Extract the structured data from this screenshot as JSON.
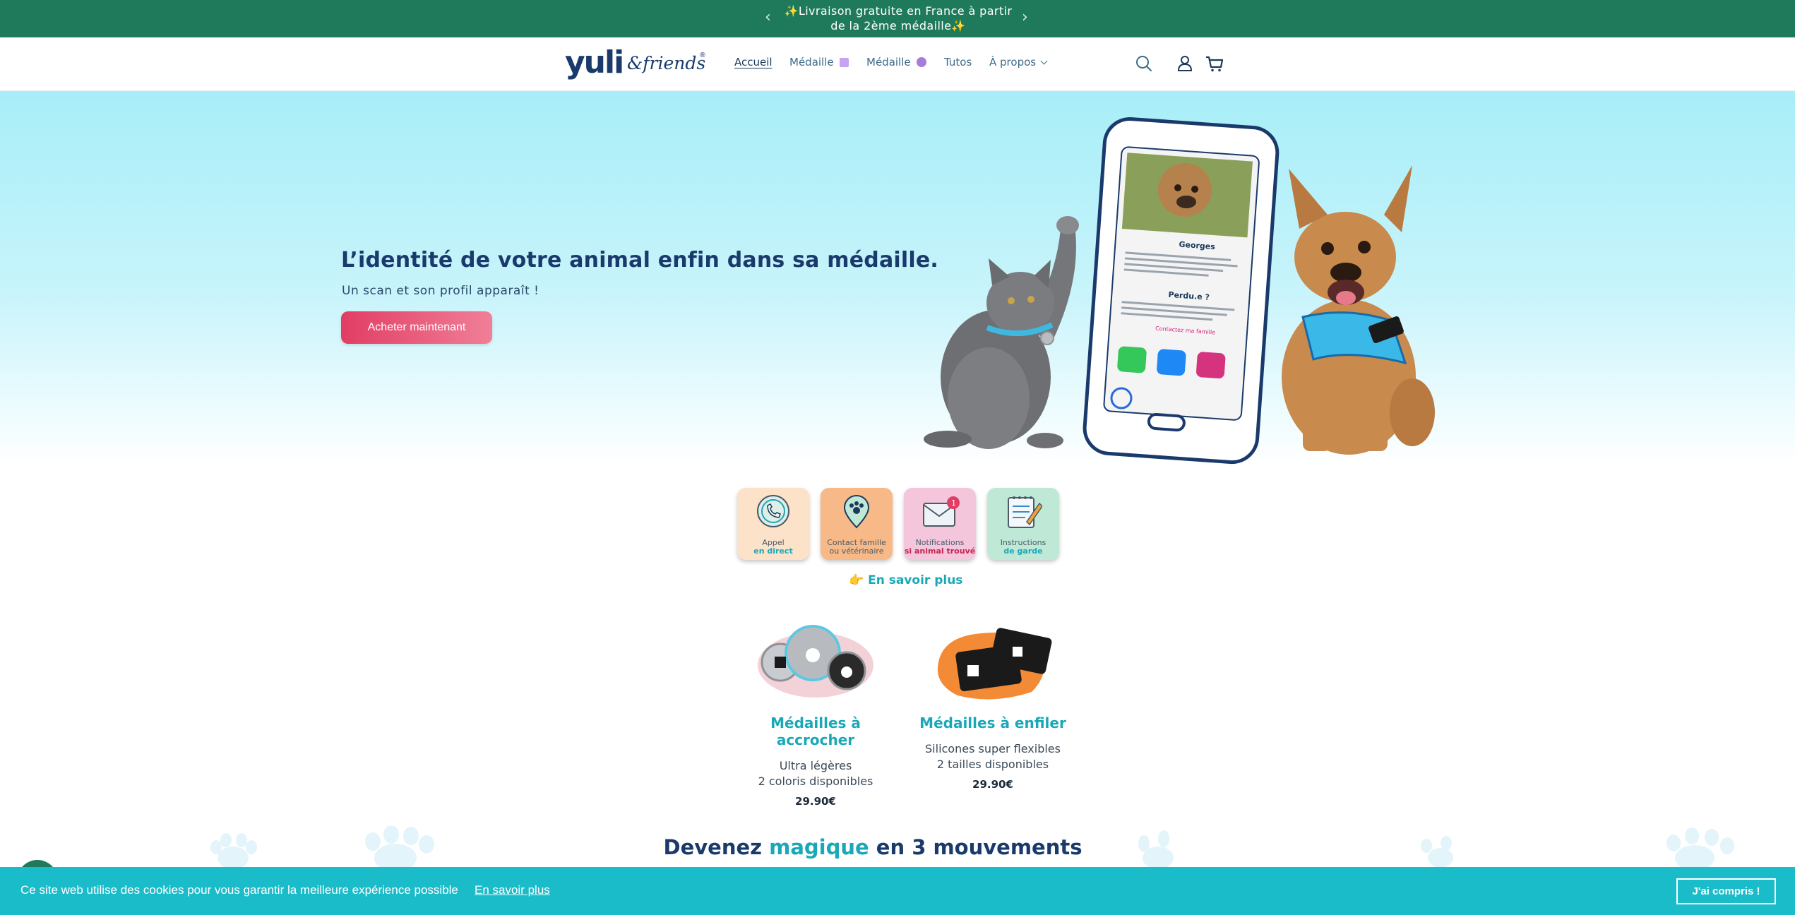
{
  "announcement": {
    "prev_icon": "chevron-left-icon",
    "next_icon": "chevron-right-icon",
    "line1": "✨Livraison gratuite en France à partir",
    "line2": "de la 2ème médaille✨"
  },
  "header": {
    "logo_main": "yuli",
    "logo_secondary": "&friends",
    "logo_mark": "®",
    "nav": [
      {
        "label": "Accueil",
        "active": true
      },
      {
        "label": "Médaille",
        "swatch": "#c6a3f0"
      },
      {
        "label": "Médaille",
        "swatch": "#a67cd9"
      },
      {
        "label": "Tutos"
      },
      {
        "label": "À propos",
        "icon": "chevron-down-icon"
      }
    ],
    "icons": [
      "search-icon",
      "account-icon",
      "cart-icon"
    ]
  },
  "hero": {
    "title": "L’identité de votre animal enfin dans sa médaille.",
    "subtitle": "Un scan et son profil apparaît !",
    "cta": "Acheter maintenant",
    "phone": {
      "pet_name": "Georges",
      "lost_heading": "Perdu.e ?",
      "contact_label": "Contactez ma famille"
    }
  },
  "features": [
    {
      "line1": "Appel",
      "line2": "en direct",
      "bg": "#fbe2c8",
      "accent": "#1aa8b8",
      "icon": "phone-icon"
    },
    {
      "line1": "Contact famille",
      "line2": "ou vétérinaire",
      "bg": "#f7b987",
      "accent": "#4a5a6a",
      "icon": "paw-pin-icon"
    },
    {
      "line1": "Notifications",
      "line2": "si animal trouvé",
      "bg": "#f3c6dc",
      "accent": "#c8234f",
      "icon": "mail-icon",
      "badge": "1"
    },
    {
      "line1": "Instructions",
      "line2": "de garde",
      "bg": "#bfe8d6",
      "accent": "#1aa8b8",
      "icon": "notepad-icon"
    }
  ],
  "learn_more": "👉 En savoir plus",
  "products": [
    {
      "name": "Médailles à accrocher",
      "desc1": "Ultra légères",
      "desc2": "2 coloris disponibles",
      "price": "29.90€"
    },
    {
      "name": "Médailles à enfiler",
      "desc1": "Silicones super flexibles",
      "desc2": "2 tailles disponibles",
      "price": "29.90€"
    }
  ],
  "section": {
    "title_before": "Devenez ",
    "title_accent": "magique",
    "title_after": " en 3 mouvements"
  },
  "cookie": {
    "text": "Ce site web utilise des cookies pour vous garantir la meilleure expérience possible",
    "link": "En savoir plus",
    "button": "J'ai compris !"
  },
  "colors": {
    "announcement_bg": "#1f7a5c",
    "brand_navy": "#1a3a6c",
    "accent_teal": "#1aa8b8",
    "cta_pink": "#e23d63",
    "cookie_bg": "#1bbcc9"
  }
}
